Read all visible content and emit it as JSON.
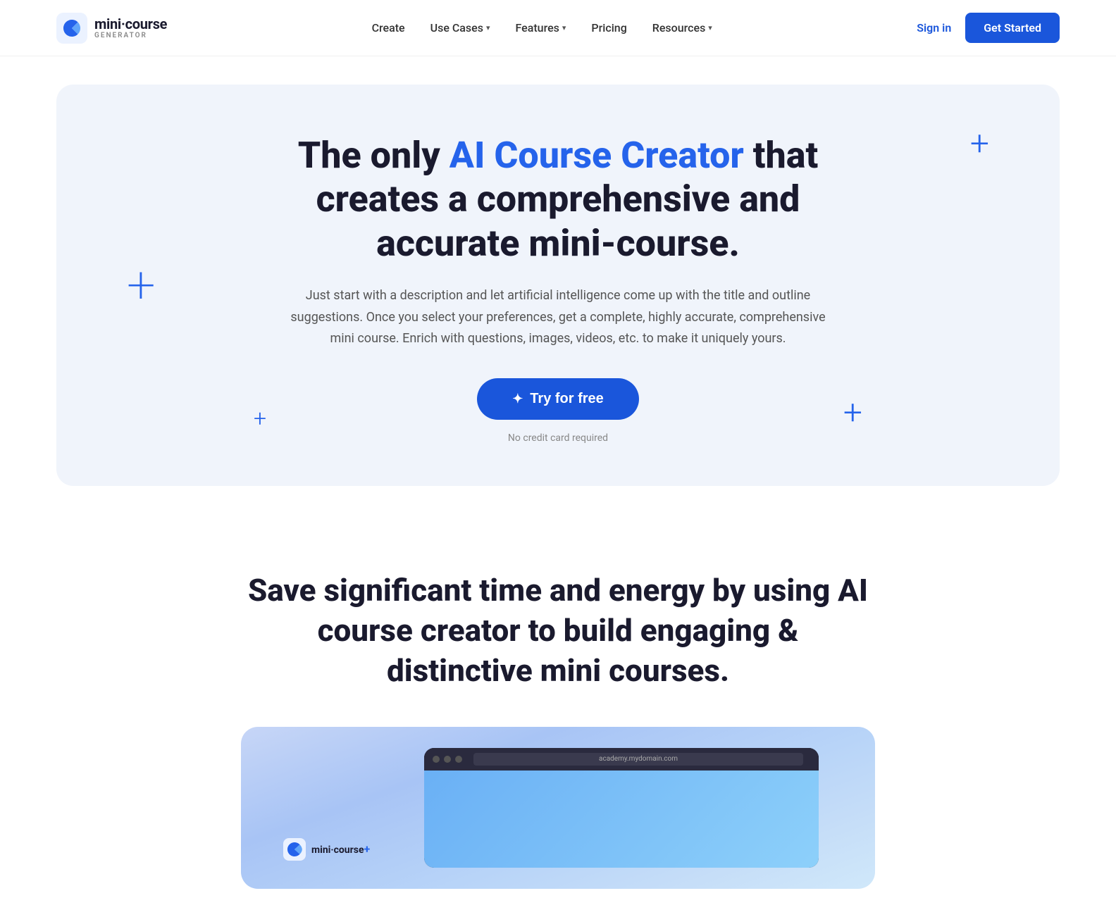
{
  "nav": {
    "logo_name": "mini·course",
    "logo_sub": "GENERATOR",
    "links": [
      {
        "label": "Create",
        "has_dropdown": false
      },
      {
        "label": "Use Cases",
        "has_dropdown": true
      },
      {
        "label": "Features",
        "has_dropdown": true
      },
      {
        "label": "Pricing",
        "has_dropdown": false
      },
      {
        "label": "Resources",
        "has_dropdown": true
      }
    ],
    "signin_label": "Sign in",
    "get_started_label": "Get Started"
  },
  "hero": {
    "title_prefix": "The only ",
    "title_highlight": "AI Course Creator",
    "title_suffix": " that creates a comprehensive and accurate mini-course.",
    "subtitle": "Just start with a description and let artificial intelligence come up with the title and outline suggestions. Once you select your preferences, get a complete, highly accurate, comprehensive mini course. Enrich with questions, images, videos, etc. to make it uniquely yours.",
    "cta_label": "Try for free",
    "cta_no_cc": "No credit card required",
    "plus_decorations": [
      "large-left",
      "top-right",
      "bottom-left",
      "bottom-right"
    ]
  },
  "save_section": {
    "title": "Save significant time and energy by using AI course creator to build engaging & distinctive mini courses."
  },
  "demo": {
    "url_text": "academy.mydomain.com",
    "brand_name": "mini·course",
    "brand_suffix": "+"
  },
  "colors": {
    "brand_blue": "#2563eb",
    "nav_blue": "#1a56db",
    "dark": "#1a1a2e",
    "hero_bg": "#f0f4fb"
  }
}
